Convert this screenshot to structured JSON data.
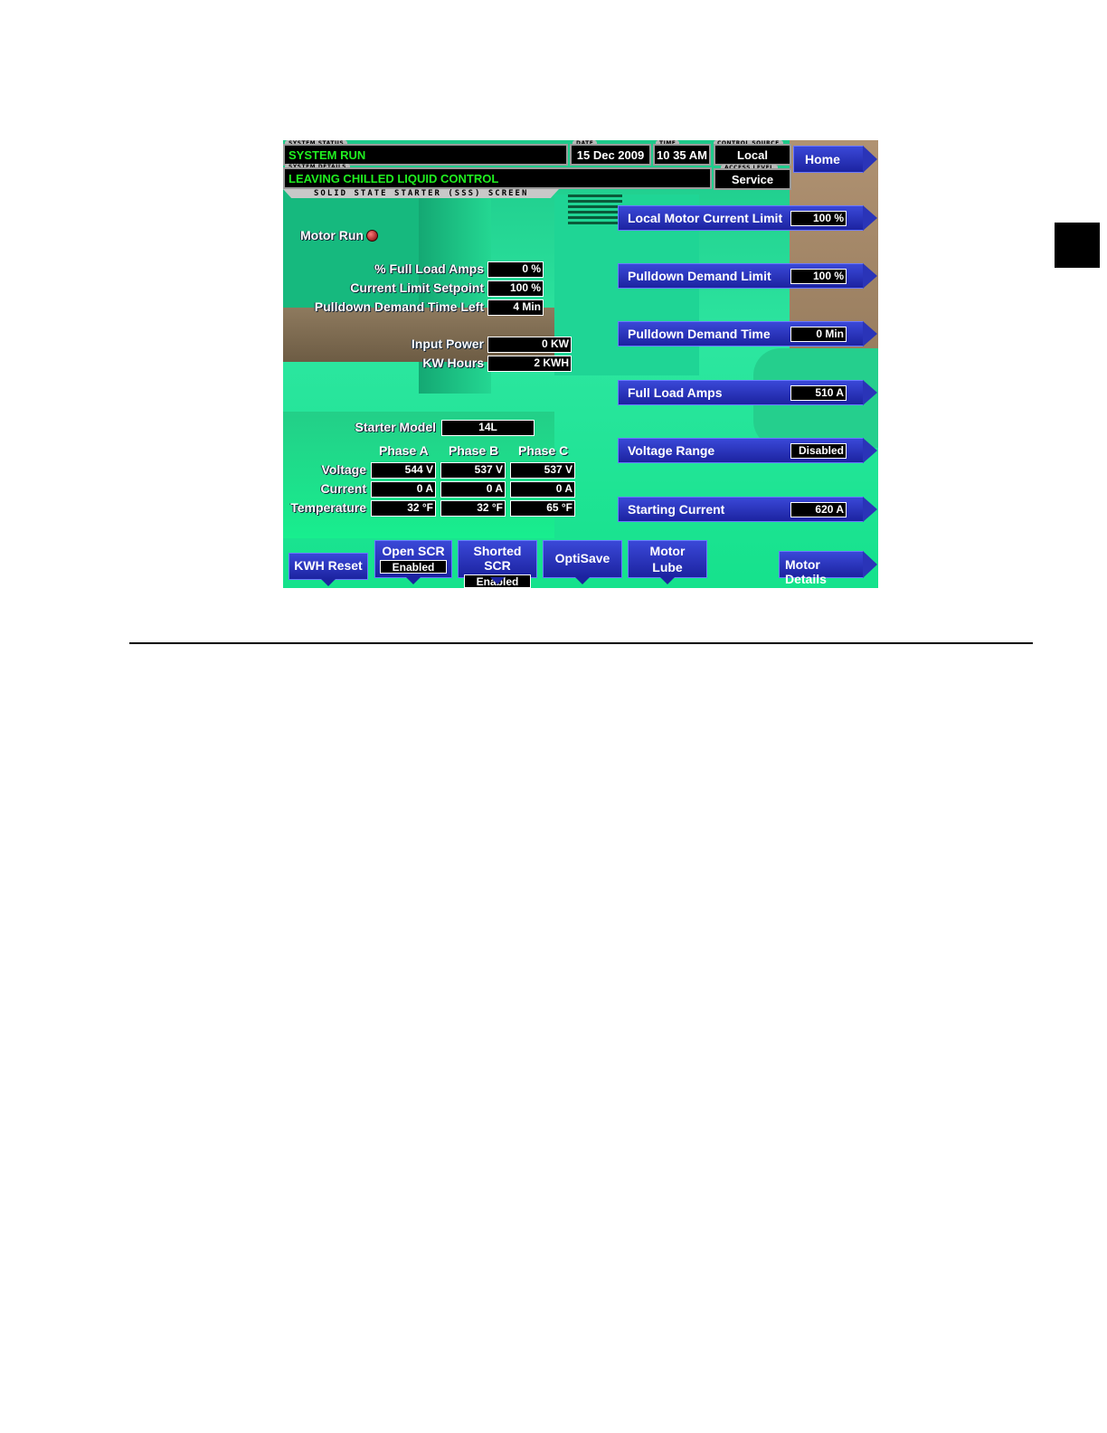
{
  "header": {
    "system_status_label": "SYSTEM STATUS",
    "system_status": "SYSTEM RUN",
    "system_details_label": "SYSTEM DETAILS",
    "system_details": "LEAVING CHILLED LIQUID CONTROL",
    "date_label": "DATE",
    "date": "15 Dec 2009",
    "time_label": "TIME",
    "time": "10 35 AM",
    "control_source_label": "CONTROL SOURCE",
    "control_source": "Local",
    "access_level_label": "ACCESS LEVEL",
    "access_level": "Service",
    "home_button": "Home",
    "screen_title": "SOLID STATE STARTER (SSS) SCREEN"
  },
  "motor": {
    "motor_run_label": "Motor Run",
    "full_load_amps_label": "% Full Load Amps",
    "full_load_amps": "0 %",
    "current_limit_setpoint_label": "Current Limit Setpoint",
    "current_limit_setpoint": "100 %",
    "pulldown_time_left_label": "Pulldown Demand Time Left",
    "pulldown_time_left": "4 Min",
    "input_power_label": "Input Power",
    "input_power": "0 KW",
    "kw_hours_label": "KW Hours",
    "kw_hours": "2 KWH",
    "starter_model_label": "Starter Model",
    "starter_model": "14L"
  },
  "phases": {
    "headers": [
      "Phase A",
      "Phase B",
      "Phase C"
    ],
    "voltage_label": "Voltage",
    "voltage": [
      "544 V",
      "537 V",
      "537 V"
    ],
    "current_label": "Current",
    "current": [
      "0 A",
      "0 A",
      "0 A"
    ],
    "temperature_label": "Temperature",
    "temperature": [
      "32 °F",
      "32 °F",
      "65 °F"
    ]
  },
  "setpoints": [
    {
      "label": "Local Motor Current Limit",
      "value": "100 %"
    },
    {
      "label": "Pulldown Demand Limit",
      "value": "100 %"
    },
    {
      "label": "Pulldown Demand Time",
      "value": "0 Min"
    },
    {
      "label": "Full Load Amps",
      "value": "510 A"
    },
    {
      "label": "Voltage Range",
      "value": "Disabled"
    },
    {
      "label": "Starting Current",
      "value": "620 A"
    }
  ],
  "bottom_buttons": {
    "kwh_reset": "KWH Reset",
    "open_scr": "Open SCR",
    "open_scr_state": "Enabled",
    "shorted_scr": "Shorted SCR",
    "shorted_scr_state": "Enabled",
    "optisave": "OptiSave",
    "motor_lube_line1": "Motor",
    "motor_lube_line2": "Lube",
    "motor_details": "Motor Details"
  },
  "colors": {
    "panel_green": "#1ee39a",
    "button_blue": "#2a34b8",
    "status_green": "#20f020"
  }
}
